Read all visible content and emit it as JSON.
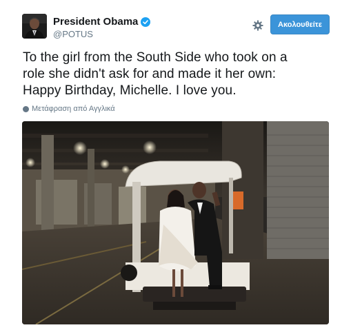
{
  "user": {
    "display_name": "President Obama",
    "screen_name": "@POTUS",
    "avatar_icon": "profile-photo",
    "verified_icon": "verified-badge-icon"
  },
  "actions": {
    "follow_label": "Ακολουθείτε",
    "settings_icon": "gear-icon"
  },
  "tweet": {
    "text_lines": [
      "To the girl from the South Side who took on a",
      "role she didn't ask for and made it her own:",
      "Happy Birthday, Michelle. I love you."
    ],
    "translate_label": "Μετάφραση από Αγγλικά"
  },
  "colors": {
    "accent": "#3b94d9",
    "verified": "#1da1f2",
    "secondary_text": "#657786"
  }
}
